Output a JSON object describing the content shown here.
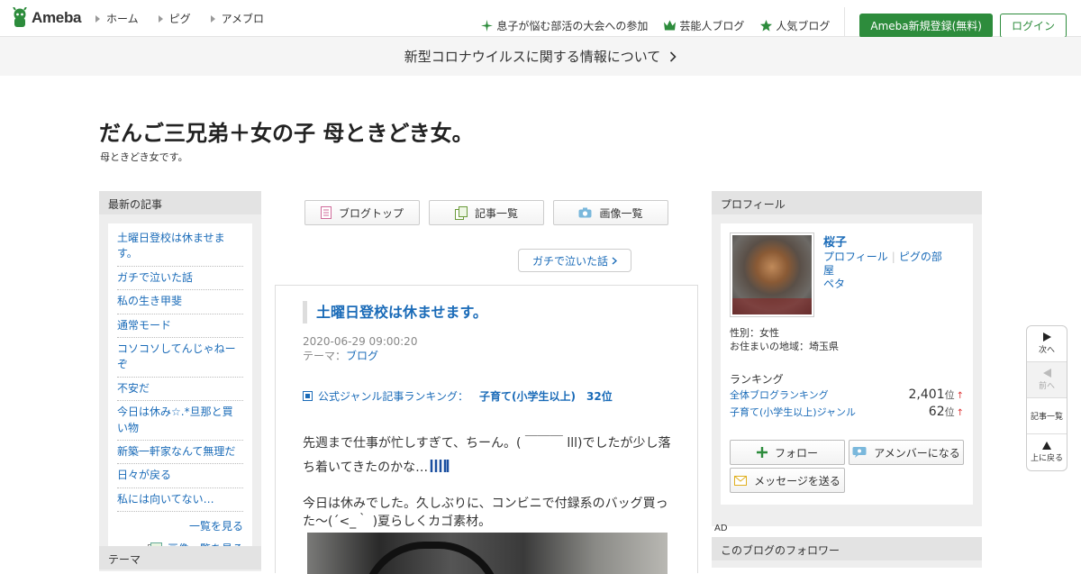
{
  "header": {
    "logo_text": "Ameba",
    "nav": [
      "ホーム",
      "ピグ",
      "アメブロ"
    ],
    "links": [
      {
        "label": "息子が悩む部活の大会への参加",
        "icon": "sparkle-icon"
      },
      {
        "label": "芸能人ブログ",
        "icon": "crown-icon"
      },
      {
        "label": "人気ブログ",
        "icon": "star-icon"
      }
    ],
    "register_label": "Ameba新規登録(無料)",
    "login_label": "ログイン"
  },
  "notice": {
    "text": "新型コロナウイルスに関する情報について"
  },
  "blog": {
    "title": "だんご三兄弟＋女の子 母ときどき女。",
    "description": "母ときどき女です。"
  },
  "recent": {
    "heading": "最新の記事",
    "items": [
      "土曜日登校は休ませます。",
      "ガチで泣いた話",
      "私の生き甲斐",
      "通常モード",
      "コソコソしてんじゃねーぞ",
      "不安だ",
      "今日は休み☆.*旦那と買い物",
      "新築一軒家なんて無理だ",
      "日々が戻る",
      "私には向いてない…"
    ],
    "more_label": "一覧を見る",
    "more_images_label": "画像一覧を見る"
  },
  "theme_box": {
    "heading": "テーマ"
  },
  "tabs": [
    "ブログトップ",
    "記事一覧",
    "画像一覧"
  ],
  "next_article_label": "ガチで泣いた話",
  "article": {
    "title": "土曜日登校は休ませます。",
    "date": "2020-06-29 09:00:20",
    "theme_prefix": "テーマ：",
    "theme": "ブログ",
    "ranking_label": "公式ジャンル記事ランキング：",
    "ranking_genre": "子育て(小学生以上)",
    "ranking_value": "32位",
    "para1": "先週まで仕事が忙しすぎて、ちーん。( ￣￣￣ lll)でしたが少し落ち着いてきたのかな…",
    "para2": "今日は休みでした。久しぶりに、コンビニで付録系のバッグ買った〜(´<_｀ )夏らしくカゴ素材。"
  },
  "profile": {
    "heading": "プロフィール",
    "name": "桜子",
    "link_profile": "プロフィール",
    "link_pig": "ピグの部屋",
    "link_peta": "ペタ",
    "gender": "性別：女性",
    "location": "お住まいの地域：埼玉県",
    "ranking_heading": "ランキング",
    "rankings": [
      {
        "label": "全体ブログランキング",
        "value": "2,401",
        "unit": "位",
        "trend": "↑"
      },
      {
        "label": "子育て(小学生以上)ジャンル",
        "value": "62",
        "unit": "位",
        "trend": "↑"
      }
    ],
    "follow_label": "フォロー",
    "amember_label": "アメンバーになる",
    "message_label": "メッセージを送る"
  },
  "ad_label": "AD",
  "followers_heading": "このブログのフォロワー",
  "float_nav": {
    "next": "次へ",
    "prev": "前へ",
    "list": "記事一覧",
    "top": "上に戻る"
  },
  "colors": {
    "brand_green": "#2d8c3c",
    "link_blue": "#1a6bb8"
  }
}
